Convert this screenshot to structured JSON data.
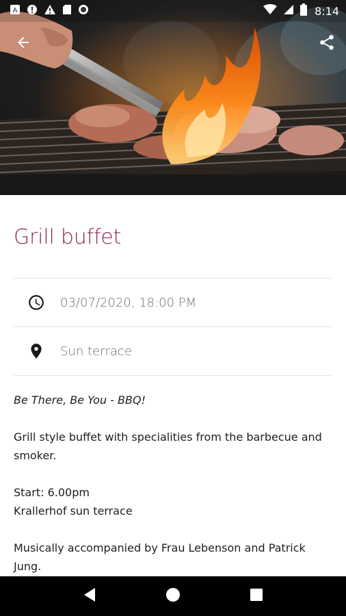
{
  "status_bar": {
    "time": "8:14",
    "icons": [
      "app-icon",
      "alert-circle-icon",
      "warning-icon",
      "sd-card-icon",
      "record-icon",
      "wifi-icon",
      "signal-icon",
      "battery-icon"
    ]
  },
  "toolbar": {
    "back_icon": "arrow-back-icon",
    "share_icon": "share-icon"
  },
  "event": {
    "title": "Grill buffet",
    "datetime": "03/07/2020, 18:00 PM",
    "location": "Sun terrace",
    "description": {
      "tagline": "Be There, Be You - BBQ!",
      "paragraph1": "Grill style buffet with specialities from the barbecue and smoker.",
      "start_line": "Start: 6.00pm",
      "venue_line": "Krallerhof sun terrace",
      "paragraph3": "Musically accompanied by Frau Lebenson and Patrick Jung."
    }
  },
  "colors": {
    "title": "#8a2a56",
    "secondary_text": "#6e6e6e",
    "divider": "#e6e6e6",
    "nav_bar": "#000000"
  },
  "nav_bar": {
    "icons": [
      "back-triangle-icon",
      "home-circle-icon",
      "recents-square-icon"
    ]
  }
}
